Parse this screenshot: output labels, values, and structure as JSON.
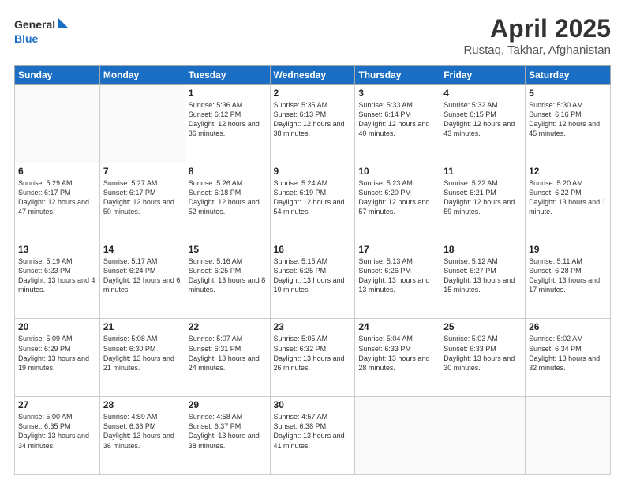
{
  "header": {
    "logo_general": "General",
    "logo_blue": "Blue",
    "month": "April 2025",
    "location": "Rustaq, Takhar, Afghanistan"
  },
  "weekdays": [
    "Sunday",
    "Monday",
    "Tuesday",
    "Wednesday",
    "Thursday",
    "Friday",
    "Saturday"
  ],
  "weeks": [
    [
      {
        "day": "",
        "info": ""
      },
      {
        "day": "",
        "info": ""
      },
      {
        "day": "1",
        "info": "Sunrise: 5:36 AM\nSunset: 6:12 PM\nDaylight: 12 hours and 36 minutes."
      },
      {
        "day": "2",
        "info": "Sunrise: 5:35 AM\nSunset: 6:13 PM\nDaylight: 12 hours and 38 minutes."
      },
      {
        "day": "3",
        "info": "Sunrise: 5:33 AM\nSunset: 6:14 PM\nDaylight: 12 hours and 40 minutes."
      },
      {
        "day": "4",
        "info": "Sunrise: 5:32 AM\nSunset: 6:15 PM\nDaylight: 12 hours and 43 minutes."
      },
      {
        "day": "5",
        "info": "Sunrise: 5:30 AM\nSunset: 6:16 PM\nDaylight: 12 hours and 45 minutes."
      }
    ],
    [
      {
        "day": "6",
        "info": "Sunrise: 5:29 AM\nSunset: 6:17 PM\nDaylight: 12 hours and 47 minutes."
      },
      {
        "day": "7",
        "info": "Sunrise: 5:27 AM\nSunset: 6:17 PM\nDaylight: 12 hours and 50 minutes."
      },
      {
        "day": "8",
        "info": "Sunrise: 5:26 AM\nSunset: 6:18 PM\nDaylight: 12 hours and 52 minutes."
      },
      {
        "day": "9",
        "info": "Sunrise: 5:24 AM\nSunset: 6:19 PM\nDaylight: 12 hours and 54 minutes."
      },
      {
        "day": "10",
        "info": "Sunrise: 5:23 AM\nSunset: 6:20 PM\nDaylight: 12 hours and 57 minutes."
      },
      {
        "day": "11",
        "info": "Sunrise: 5:22 AM\nSunset: 6:21 PM\nDaylight: 12 hours and 59 minutes."
      },
      {
        "day": "12",
        "info": "Sunrise: 5:20 AM\nSunset: 6:22 PM\nDaylight: 13 hours and 1 minute."
      }
    ],
    [
      {
        "day": "13",
        "info": "Sunrise: 5:19 AM\nSunset: 6:23 PM\nDaylight: 13 hours and 4 minutes."
      },
      {
        "day": "14",
        "info": "Sunrise: 5:17 AM\nSunset: 6:24 PM\nDaylight: 13 hours and 6 minutes."
      },
      {
        "day": "15",
        "info": "Sunrise: 5:16 AM\nSunset: 6:25 PM\nDaylight: 13 hours and 8 minutes."
      },
      {
        "day": "16",
        "info": "Sunrise: 5:15 AM\nSunset: 6:25 PM\nDaylight: 13 hours and 10 minutes."
      },
      {
        "day": "17",
        "info": "Sunrise: 5:13 AM\nSunset: 6:26 PM\nDaylight: 13 hours and 13 minutes."
      },
      {
        "day": "18",
        "info": "Sunrise: 5:12 AM\nSunset: 6:27 PM\nDaylight: 13 hours and 15 minutes."
      },
      {
        "day": "19",
        "info": "Sunrise: 5:11 AM\nSunset: 6:28 PM\nDaylight: 13 hours and 17 minutes."
      }
    ],
    [
      {
        "day": "20",
        "info": "Sunrise: 5:09 AM\nSunset: 6:29 PM\nDaylight: 13 hours and 19 minutes."
      },
      {
        "day": "21",
        "info": "Sunrise: 5:08 AM\nSunset: 6:30 PM\nDaylight: 13 hours and 21 minutes."
      },
      {
        "day": "22",
        "info": "Sunrise: 5:07 AM\nSunset: 6:31 PM\nDaylight: 13 hours and 24 minutes."
      },
      {
        "day": "23",
        "info": "Sunrise: 5:05 AM\nSunset: 6:32 PM\nDaylight: 13 hours and 26 minutes."
      },
      {
        "day": "24",
        "info": "Sunrise: 5:04 AM\nSunset: 6:33 PM\nDaylight: 13 hours and 28 minutes."
      },
      {
        "day": "25",
        "info": "Sunrise: 5:03 AM\nSunset: 6:33 PM\nDaylight: 13 hours and 30 minutes."
      },
      {
        "day": "26",
        "info": "Sunrise: 5:02 AM\nSunset: 6:34 PM\nDaylight: 13 hours and 32 minutes."
      }
    ],
    [
      {
        "day": "27",
        "info": "Sunrise: 5:00 AM\nSunset: 6:35 PM\nDaylight: 13 hours and 34 minutes."
      },
      {
        "day": "28",
        "info": "Sunrise: 4:59 AM\nSunset: 6:36 PM\nDaylight: 13 hours and 36 minutes."
      },
      {
        "day": "29",
        "info": "Sunrise: 4:58 AM\nSunset: 6:37 PM\nDaylight: 13 hours and 38 minutes."
      },
      {
        "day": "30",
        "info": "Sunrise: 4:57 AM\nSunset: 6:38 PM\nDaylight: 13 hours and 41 minutes."
      },
      {
        "day": "",
        "info": ""
      },
      {
        "day": "",
        "info": ""
      },
      {
        "day": "",
        "info": ""
      }
    ]
  ]
}
